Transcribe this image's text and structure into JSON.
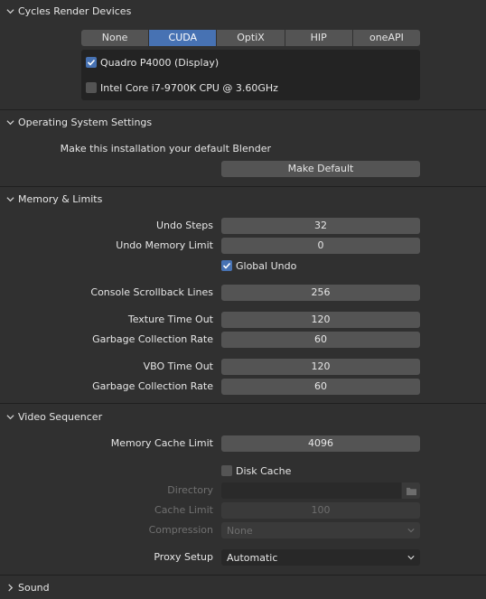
{
  "sections": {
    "cycles": "Cycles Render Devices",
    "os": "Operating System Settings",
    "memory": "Memory & Limits",
    "vse": "Video Sequencer",
    "sound": "Sound"
  },
  "cycles": {
    "tabs": [
      "None",
      "CUDA",
      "OptiX",
      "HIP",
      "oneAPI"
    ],
    "active_tab": "CUDA",
    "devices": [
      {
        "label": "Quadro P4000 (Display)",
        "checked": true
      },
      {
        "label": "Intel Core i7-9700K CPU @ 3.60GHz",
        "checked": false
      }
    ]
  },
  "os": {
    "text": "Make this installation your default Blender",
    "button": "Make Default"
  },
  "memory": {
    "undo_steps_label": "Undo Steps",
    "undo_steps": "32",
    "undo_memory_label": "Undo Memory Limit",
    "undo_memory": "0",
    "global_undo": "Global Undo",
    "console_label": "Console Scrollback Lines",
    "console": "256",
    "tex_timeout_label": "Texture Time Out",
    "tex_timeout": "120",
    "gc_rate_label": "Garbage Collection Rate",
    "gc_rate": "60",
    "vbo_timeout_label": "VBO Time Out",
    "vbo_timeout": "120",
    "gc_rate2_label": "Garbage Collection Rate",
    "gc_rate2": "60"
  },
  "vse": {
    "cache_limit_label": "Memory Cache Limit",
    "cache_limit": "4096",
    "disk_cache": "Disk Cache",
    "directory_label": "Directory",
    "directory": "",
    "disk_limit_label": "Cache Limit",
    "disk_limit": "100",
    "compression_label": "Compression",
    "compression": "None",
    "proxy_label": "Proxy Setup",
    "proxy": "Automatic"
  },
  "colors": {
    "accent": "#4772b3",
    "field": "#545454",
    "bg": "#303030"
  }
}
